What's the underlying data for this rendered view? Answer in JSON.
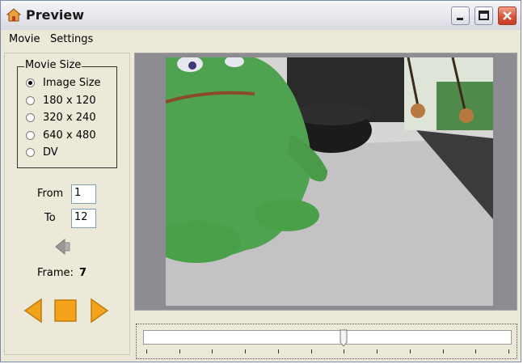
{
  "window": {
    "title": "Preview"
  },
  "menubar": {
    "items": [
      "Movie",
      "Settings"
    ]
  },
  "movie_size": {
    "legend": "Movie Size",
    "options": [
      "Image Size",
      "180 x 120",
      "320 x 240",
      "640 x 480",
      "DV"
    ],
    "selected": "Image Size"
  },
  "range": {
    "from_label": "From",
    "from_value": "1",
    "to_label": "To",
    "to_value": "12"
  },
  "frame": {
    "label": "Frame:",
    "value": "7"
  },
  "playback": {
    "buttons": [
      "rewind-icon",
      "stop-icon",
      "play-icon"
    ],
    "accent": "#f0a020"
  },
  "timeline": {
    "position": 0.545
  }
}
